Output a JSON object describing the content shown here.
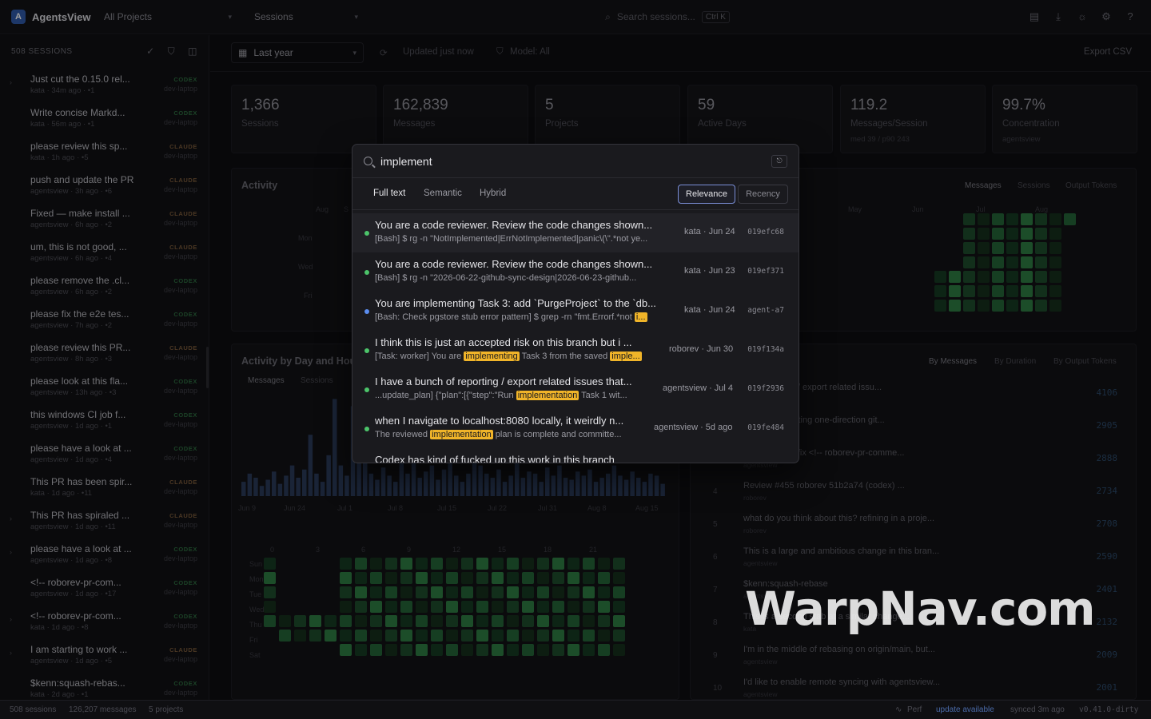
{
  "app": {
    "name": "AgentsView",
    "logo_letter": "A"
  },
  "topbar": {
    "project_select": "All Projects",
    "view_select": "Sessions",
    "search_placeholder": "Search sessions...",
    "search_shortcut": "Ctrl K",
    "icons": [
      "database-icon",
      "download-icon",
      "theme-icon",
      "settings-icon",
      "help-icon"
    ]
  },
  "sidebar": {
    "header": "508 SESSIONS",
    "sessions": [
      {
        "title": "Just cut the 0.15.0 rel...",
        "meta": "kata · 34m ago · •1",
        "agent": "CODEX",
        "host": "dev-laptop",
        "expandable": true
      },
      {
        "title": "Write concise Markd...",
        "meta": "kata · 56m ago · •1",
        "agent": "CODEX",
        "host": "dev-laptop",
        "expandable": false
      },
      {
        "title": "please review this sp...",
        "meta": "kata · 1h ago · •5",
        "agent": "CLAUDE",
        "host": "dev-laptop",
        "expandable": false
      },
      {
        "title": "push and update the PR",
        "meta": "agentsview · 3h ago · •6",
        "agent": "CLAUDE",
        "host": "dev-laptop",
        "expandable": false
      },
      {
        "title": "Fixed — make install ...",
        "meta": "agentsview · 6h ago · •2",
        "agent": "CLAUDE",
        "host": "dev-laptop",
        "expandable": false
      },
      {
        "title": "um, this is not good, ...",
        "meta": "agentsview · 6h ago · •4",
        "agent": "CLAUDE",
        "host": "dev-laptop",
        "expandable": false
      },
      {
        "title": "please remove the .cl...",
        "meta": "agentsview · 6h ago · •2",
        "agent": "CODEX",
        "host": "dev-laptop",
        "expandable": false
      },
      {
        "title": "please fix the e2e tes...",
        "meta": "agentsview · 7h ago · •2",
        "agent": "CODEX",
        "host": "dev-laptop",
        "expandable": false
      },
      {
        "title": "please review this PR...",
        "meta": "agentsview · 8h ago · •3",
        "agent": "CLAUDE",
        "host": "dev-laptop",
        "expandable": false
      },
      {
        "title": "please look at this fla...",
        "meta": "agentsview · 13h ago · •3",
        "agent": "CODEX",
        "host": "dev-laptop",
        "expandable": false
      },
      {
        "title": "this windows CI job f...",
        "meta": "agentsview · 1d ago · •1",
        "agent": "CODEX",
        "host": "dev-laptop",
        "expandable": false
      },
      {
        "title": "please have a look at ...",
        "meta": "agentsview · 1d ago · •4",
        "agent": "CODEX",
        "host": "dev-laptop",
        "expandable": false
      },
      {
        "title": "This PR has been spir...",
        "meta": "kata · 1d ago · •11",
        "agent": "CLAUDE",
        "host": "dev-laptop",
        "expandable": false
      },
      {
        "title": "This PR has spiraled ...",
        "meta": "agentsview · 1d ago · •11",
        "agent": "CLAUDE",
        "host": "dev-laptop",
        "expandable": true
      },
      {
        "title": "please have a look at ...",
        "meta": "agentsview · 1d ago · •8",
        "agent": "CODEX",
        "host": "dev-laptop",
        "expandable": true
      },
      {
        "title": "<!-- roborev-pr-com...",
        "meta": "agentsview · 1d ago · •17",
        "agent": "CODEX",
        "host": "dev-laptop",
        "expandable": false
      },
      {
        "title": "<!-- roborev-pr-com...",
        "meta": "kata · 1d ago · •8",
        "agent": "CODEX",
        "host": "dev-laptop",
        "expandable": true
      },
      {
        "title": "I am starting to work ...",
        "meta": "agentsview · 1d ago · •5",
        "agent": "CLAUDE",
        "host": "dev-laptop",
        "expandable": true
      },
      {
        "title": "$kenn:squash-rebas...",
        "meta": "kata · 2d ago · •1",
        "agent": "CODEX",
        "host": "dev-laptop",
        "expandable": false
      }
    ]
  },
  "toolbar": {
    "range": "Last year",
    "updated": "Updated just now",
    "model": "Model: All",
    "export": "Export CSV"
  },
  "stats": [
    {
      "value": "1,366",
      "label": "Sessions",
      "sub": ""
    },
    {
      "value": "162,839",
      "label": "Messages",
      "sub": ""
    },
    {
      "value": "5",
      "label": "Projects",
      "sub": ""
    },
    {
      "value": "59",
      "label": "Active Days",
      "sub": ""
    },
    {
      "value": "119.2",
      "label": "Messages/Session",
      "sub": "med 39 / p90 243"
    },
    {
      "value": "99.7%",
      "label": "Concentration",
      "sub": "agentsview"
    }
  ],
  "activity": {
    "title": "Activity",
    "months_left": [
      "Aug",
      "S"
    ],
    "months_right": [
      "May",
      "Jun",
      "Jul",
      "Aug"
    ],
    "days": [
      "Mon",
      "Wed",
      "Fri"
    ],
    "tabs": [
      "Messages",
      "Sessions",
      "Output Tokens"
    ]
  },
  "day_hour": {
    "title": "Activity by Day and Hour",
    "tabs": [
      "Messages",
      "Sessions"
    ],
    "date_ticks": [
      "Jun 9",
      "Jun 24",
      "Jul 1",
      "Jul 8",
      "Jul 15",
      "Jul 22",
      "Jul 31",
      "Aug 8",
      "Aug 15"
    ],
    "hour_ticks": [
      "0",
      "3",
      "6",
      "9",
      "12",
      "15",
      "18",
      "21"
    ],
    "days": [
      "Sun",
      "Mon",
      "Tue",
      "Wed",
      "Thu",
      "Fri",
      "Sat"
    ]
  },
  "top_sessions": {
    "tabs": [
      "By Messages",
      "By Duration",
      "By Output Tokens"
    ],
    "rows": [
      {
        "rank": "1",
        "title": "h of reporting / export related issu...",
        "sub": "",
        "value": "4106"
      },
      {
        "rank": "2",
        "title": "d in implementing one-direction git...",
        "sub": "",
        "value": "2905"
      },
      {
        "rank": "3",
        "title": "n-rebase and fix <!-- roborev-pr-comme...",
        "sub": "agentsview",
        "value": "2888"
      },
      {
        "rank": "4",
        "title": "Review #455 roborev 51b2a74 (codex) ...",
        "sub": "roborev",
        "value": "2734"
      },
      {
        "rank": "5",
        "title": "what do you think about this? refining in a proje...",
        "sub": "roborev",
        "value": "2708"
      },
      {
        "rank": "6",
        "title": "This is a large and ambitious change in this bran...",
        "sub": "agentsview",
        "value": "2590"
      },
      {
        "rank": "7",
        "title": "$kenn:squash-rebase",
        "sub": "agentsview",
        "value": "2401"
      },
      {
        "rank": "8",
        "title": "This is a second stab at a similar change...",
        "sub": "kata",
        "value": "2132"
      },
      {
        "rank": "9",
        "title": "I'm in the middle of rebasing on origin/main, but...",
        "sub": "agentsview",
        "value": "2009"
      },
      {
        "rank": "10",
        "title": "I'd like to enable remote syncing with agentsview...",
        "sub": "agentsview",
        "value": "2001"
      }
    ]
  },
  "statusbar": {
    "sessions": "508 sessions",
    "messages": "126,207 messages",
    "projects": "5 projects",
    "perf": "Perf",
    "update": "update available",
    "synced": "synced 3m ago",
    "version": "v0.41.0-dirty"
  },
  "search_modal": {
    "query": "implement",
    "esc_label": "⎋",
    "modes": [
      "Full text",
      "Semantic",
      "Hybrid"
    ],
    "active_mode": "Full text",
    "sorts": [
      "Relevance",
      "Recency"
    ],
    "active_sort": "Relevance",
    "results": [
      {
        "title": "You are a code reviewer. Review the code changes shown...",
        "snippet_pre": "[Bash] $ rg -n \"NotImplemented|ErrNotImplemented|panic\\(\\\".*not ye...",
        "highlight": "",
        "snippet_post": "",
        "meta": "kata · Jun 24",
        "id": "019efc68",
        "dot": "#4cc46a"
      },
      {
        "title": "You are a code reviewer. Review the code changes shown...",
        "snippet_pre": "[Bash] $ rg -n \"2026-06-22-github-sync-design|2026-06-23-github...",
        "highlight": "",
        "snippet_post": "",
        "meta": "kata · Jun 23",
        "id": "019ef371",
        "dot": "#4cc46a"
      },
      {
        "title": "You are implementing Task 3: add `PurgeProject` to the `db...",
        "snippet_pre": "[Bash: Check pgstore stub error pattern] $ grep -rn \"fmt.Errorf.*not",
        "highlight": "i...",
        "snippet_post": "",
        "meta": "kata · Jun 24",
        "id": "agent-a7",
        "dot": "#5b8def"
      },
      {
        "title": "I think this is just an accepted risk on this branch but i ...",
        "snippet_pre": "[Task: worker] You are",
        "highlight": "implementing",
        "snippet_post": "Task 3 from the saved",
        "meta": "roborev · Jun 30",
        "id": "019f134a",
        "dot": "#4cc46a",
        "highlight2": "imple..."
      },
      {
        "title": "I have a bunch of reporting / export related issues that...",
        "snippet_pre": "...update_plan] {\"plan\":[{\"step\":\"Run",
        "highlight": "implementation",
        "snippet_post": "Task 1 wit...",
        "meta": "agentsview · Jul 4",
        "id": "019f2936",
        "dot": "#4cc46a"
      },
      {
        "title": "when I navigate to localhost:8080 locally, it weirdly n...",
        "snippet_pre": "The reviewed",
        "highlight": "implementation",
        "snippet_post": "plan is complete and committe...",
        "meta": "agentsview · 5d ago",
        "id": "019fe484",
        "dot": "#4cc46a"
      },
      {
        "title": "Codex has kind of fucked up this work in this branch",
        "snippet_pre": "",
        "highlight": "",
        "snippet_post": "",
        "meta": "",
        "id": "",
        "dot": "#4cc46a"
      }
    ]
  },
  "watermark": "WarpNav.com"
}
